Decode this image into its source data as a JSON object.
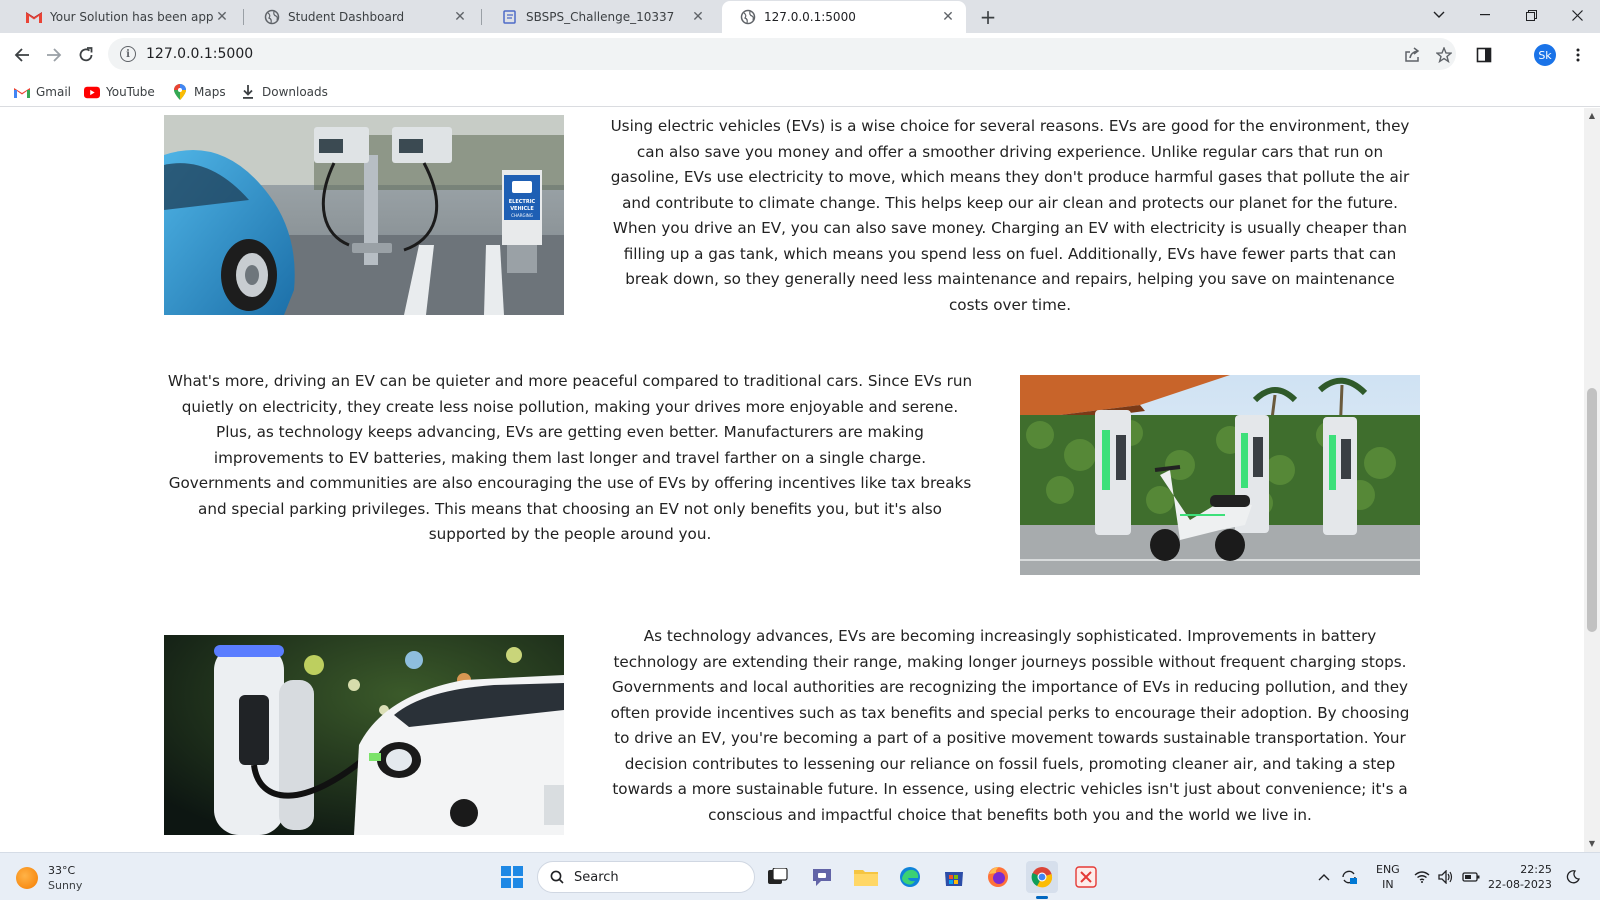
{
  "browser": {
    "tabs": [
      {
        "title": "Your Solution has been approved",
        "icon": "gmail-icon",
        "active": false
      },
      {
        "title": "Student Dashboard",
        "icon": "globe-icon",
        "active": false
      },
      {
        "title": "SBSPS_Challenge_10337",
        "icon": "docs-icon",
        "active": false
      },
      {
        "title": "127.0.0.1:5000",
        "icon": "globe-icon",
        "active": true
      }
    ],
    "url": "127.0.0.1:5000",
    "profile_initials": "Sk",
    "bookmarks": [
      {
        "label": "Gmail",
        "icon": "gmail-icon"
      },
      {
        "label": "YouTube",
        "icon": "youtube-icon"
      },
      {
        "label": "Maps",
        "icon": "maps-pin-icon"
      },
      {
        "label": "Downloads",
        "icon": "download-icon"
      }
    ]
  },
  "page": {
    "sections": [
      {
        "text": "Using electric vehicles (EVs) is a wise choice for several reasons. EVs are good for the environment, they can also save you money and offer a smoother driving experience. Unlike regular cars that run on gasoline, EVs use electricity to move, which means they don't produce harmful gases that pollute the air and contribute to climate change. This helps keep our air clean and protects our planet for the future. When you drive an EV, you can also save money. Charging an EV with electricity is usually cheaper than filling up a gas tank, which means you spend less on fuel. Additionally, EVs have fewer parts that can break down, so they generally need less maintenance and repairs, helping you save on maintenance costs over time.",
        "image_sign": "ELECTRIC VEHICLE CHARGING STATION"
      },
      {
        "text": "What's more, driving an EV can be quieter and more peaceful compared to traditional cars. Since EVs run quietly on electricity, they create less noise pollution, making your drives more enjoyable and serene. Plus, as technology keeps advancing, EVs are getting even better. Manufacturers are making improvements to EV batteries, making them last longer and travel farther on a single charge. Governments and communities are also encouraging the use of EVs by offering incentives like tax breaks and special parking privileges. This means that choosing an EV not only benefits you, but it's also supported by the people around you."
      },
      {
        "text": "As technology advances, EVs are becoming increasingly sophisticated. Improvements in battery technology are extending their range, making longer journeys possible without frequent charging stops. Governments and local authorities are recognizing the importance of EVs in reducing pollution, and they often provide incentives such as tax benefits and special perks to encourage their adoption. By choosing to drive an EV, you're becoming a part of a positive movement towards sustainable transportation. Your decision contributes to lessening our reliance on fossil fuels, promoting cleaner air, and taking a step towards a more sustainable future. In essence, using electric vehicles isn't just about convenience; it's a conscious and impactful choice that benefits both you and the world we live in."
      }
    ]
  },
  "taskbar": {
    "weather_temp": "33°C",
    "weather_cond": "Sunny",
    "search_label": "Search",
    "lang_top": "ENG",
    "lang_bottom": "IN",
    "time": "22:25",
    "date": "22-08-2023"
  }
}
